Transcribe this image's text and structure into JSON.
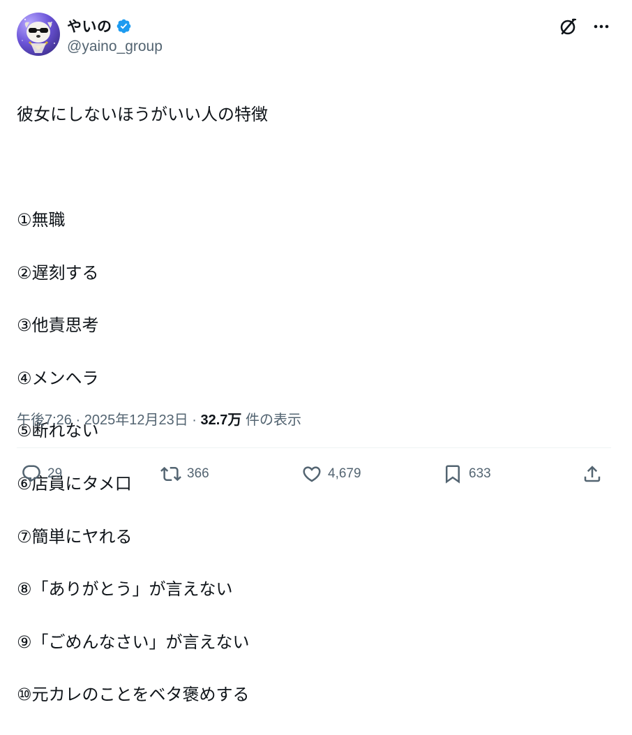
{
  "author": {
    "display_name": "やいの",
    "handle": "@yaino_group",
    "verified": true,
    "avatar_icon": "avatar-dog-sunglasses-icon"
  },
  "header_actions": {
    "grok_icon": "grok-icon",
    "more_icon": "more-icon"
  },
  "tweet": {
    "lines": [
      "彼女にしないほうがいい人の特徴",
      "",
      "①無職",
      "②遅刻する",
      "③他責思考",
      "④メンヘラ",
      "⑤断れない",
      "⑥店員にタメ口",
      "⑦簡単にヤれる",
      "⑧「ありがとう」が言えない",
      "⑨「ごめんなさい」が言えない",
      "⑩元カレのことをベタ褒めする"
    ]
  },
  "meta": {
    "time": "午後7:26",
    "separator": " · ",
    "date": "2025年12月23日",
    "views_count": "32.7万",
    "views_label": " 件の表示"
  },
  "engagement": {
    "replies": "29",
    "retweets": "366",
    "likes": "4,679",
    "bookmarks": "633"
  },
  "colors": {
    "text_primary": "#0f1419",
    "text_secondary": "#536471",
    "verified_blue": "#1d9bf0",
    "divider": "#eff3f4"
  }
}
